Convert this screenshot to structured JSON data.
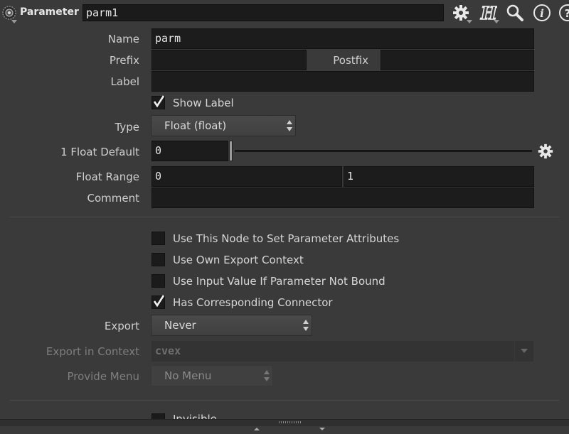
{
  "header": {
    "title": "Parameter",
    "node_name": "parm1",
    "icons": [
      "gear-icon",
      "help-h-icon",
      "search-icon",
      "info-icon",
      "help-question-icon"
    ]
  },
  "fields": {
    "name_label": "Name",
    "name_value": "parm",
    "prefix_label": "Prefix",
    "prefix_value": "",
    "postfix_label": "Postfix",
    "postfix_value": "",
    "label_label": "Label",
    "label_value": "",
    "show_label": "Show Label",
    "show_label_checked": true,
    "type_label": "Type",
    "type_value": "Float (float)",
    "float_default_label": "1 Float Default",
    "float_default_value": "0",
    "float_range_label": "Float Range",
    "float_range_min": "0",
    "float_range_max": "1",
    "comment_label": "Comment",
    "comment_value": ""
  },
  "options": {
    "use_node_attrs": "Use This Node to Set Parameter Attributes",
    "use_own_export": "Use Own Export Context",
    "use_input_value": "Use Input Value If Parameter Not Bound",
    "has_connector": "Has Corresponding Connector",
    "has_connector_checked": true,
    "export_label": "Export",
    "export_value": "Never",
    "export_context_label": "Export in Context",
    "export_context_value": "cvex",
    "provide_menu_label": "Provide Menu",
    "provide_menu_value": "No Menu",
    "invisible_label": "Invisible"
  },
  "colors": {
    "background": "#3a3a3a",
    "field": "#1c1c1c",
    "text": "#d2d2d2"
  }
}
